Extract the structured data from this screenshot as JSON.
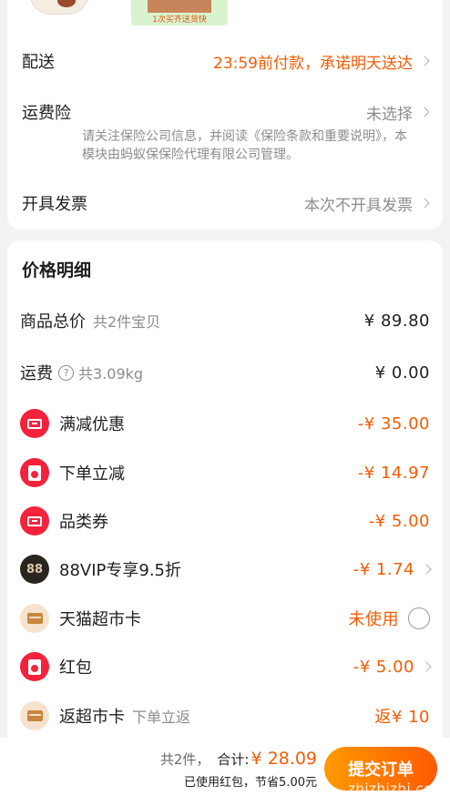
{
  "products": {
    "gift_caption": "1次买齐送货快"
  },
  "delivery": {
    "label": "配送",
    "value": "23:59前付款，承诺明天送达"
  },
  "insurance": {
    "label": "运费险",
    "value": "未选择",
    "note": "请关注保险公司信息，并阅读《保险条款和重要说明》，本模块由蚂蚁保保险代理有限公司管理。"
  },
  "invoice": {
    "label": "开具发票",
    "value": "本次不开具发票"
  },
  "price_detail": {
    "title": "价格明细",
    "goods_total": {
      "label": "商品总价",
      "sub": "共2件宝贝",
      "value": "¥ 89.80"
    },
    "shipping": {
      "label": "运费",
      "help_icon": "?",
      "sub": "共3.09kg",
      "value": "¥ 0.00"
    },
    "full_reduction": {
      "label": "满减优惠",
      "value": "-¥ 35.00"
    },
    "order_reduction": {
      "label": "下单立减",
      "value": "-¥ 14.97"
    },
    "category_coupon": {
      "label": "品类券",
      "value": "-¥ 5.00"
    },
    "vip": {
      "badge": "88",
      "label": "88VIP专享9.5折",
      "value": "-¥ 1.74"
    },
    "supermarket_card": {
      "label": "天猫超市卡",
      "value": "未使用"
    },
    "red_packet": {
      "label": "红包",
      "value": "-¥ 5.00"
    },
    "cashback_card": {
      "label": "返超市卡",
      "sub": "下单立返",
      "value": "返¥ 10"
    }
  },
  "bottom": {
    "count": "共2件，",
    "total_label": "合计:",
    "total": "¥ 28.09",
    "note": "已使用红包，节省5.00元",
    "submit": "提交订单",
    "watermark": "zhizhizhi.com"
  },
  "colors": {
    "accent": "#f25c05",
    "coupon_red": "#f5223c",
    "vip_dark": "#2b2520"
  }
}
